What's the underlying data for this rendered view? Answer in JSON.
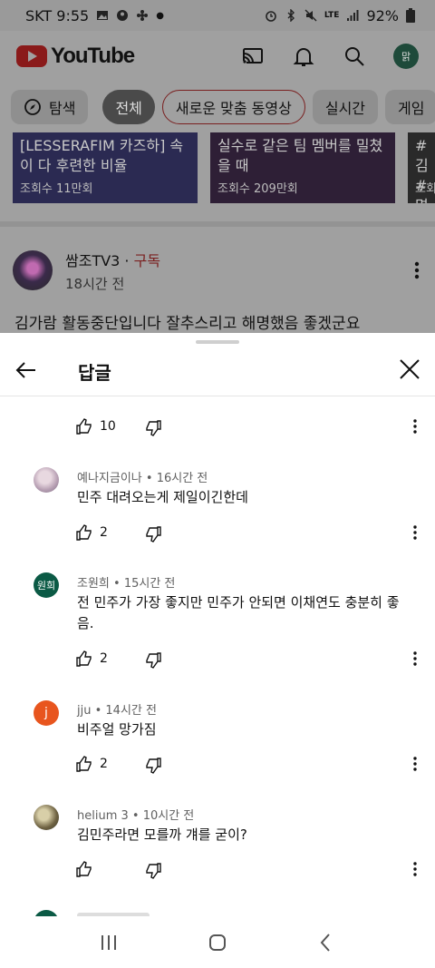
{
  "status": {
    "carrier_time": "SKT 9:55",
    "battery": "92%",
    "network": "LTE"
  },
  "header": {
    "logo_text": "YouTube",
    "account_initial": "맑"
  },
  "chips": {
    "explore": "탐색",
    "all": "전체",
    "new_for_you": "새로운 맞춤 동영상",
    "live": "실시간",
    "game": "게임"
  },
  "thumbnails": [
    {
      "title": "[LESSERAFIM 카즈하] 속이 다 후련한 비율",
      "views": "조회수 11만회"
    },
    {
      "title": "실수로 같은 팀 멤버를 밀쳤을 때",
      "views": "조회수 209만회"
    },
    {
      "title": "#김 #명",
      "views": "조회"
    }
  ],
  "post": {
    "channel": "쌈조TV3",
    "separator": " · ",
    "subscribe": "구독",
    "time": "18시간 전",
    "text": "김가람 활동중단입니다 잘추스리고 해명했음 좋겠군요"
  },
  "sheet": {
    "title": "답글"
  },
  "comments": [
    {
      "author": "",
      "meta": "",
      "text": "",
      "likes": "10",
      "avatar_initial": "",
      "avatar_color": ""
    },
    {
      "author": "예나지금이나",
      "meta": "예나지금이나 • 16시간 전",
      "text": "민주 대려오는게 제일이긴한데",
      "likes": "2",
      "avatar_initial": "",
      "avatar_color": "#c9b6c6"
    },
    {
      "author": "조원희",
      "meta": "조원희 • 15시간 전",
      "text": "전 민주가 가장 좋지만 민주가 안되면 이채연도 충분히 좋음.",
      "likes": "2",
      "avatar_initial": "원희",
      "avatar_color": "#0b5a45"
    },
    {
      "author": "jju",
      "meta": "jju • 14시간 전",
      "text": "비주얼 망가짐",
      "likes": "2",
      "avatar_initial": "j",
      "avatar_color": "#e8551e"
    },
    {
      "author": "helium 3",
      "meta": "helium 3 • 10시간 전",
      "text": "김민주라면 모를까 걔를 굳이?",
      "likes": "",
      "avatar_initial": "",
      "avatar_color": "#8a7d5a"
    },
    {
      "author": "",
      "meta": "",
      "text": "",
      "likes": "",
      "avatar_initial": "",
      "avatar_color": "#0b5a45"
    }
  ],
  "colors": {
    "brand_red": "#ff0000",
    "subscribe_red": "#cc0000"
  }
}
